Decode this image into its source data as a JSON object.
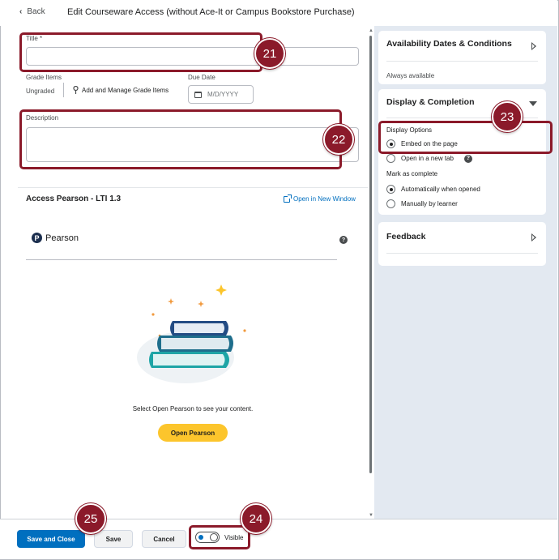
{
  "header": {
    "back_label": "Back",
    "title": "Edit Courseware Access (without Ace-It or Campus Bookstore Purchase)"
  },
  "form": {
    "title_label": "Title *",
    "title_value": "",
    "grade_items_label": "Grade Items",
    "grade_value": "Ungraded",
    "add_grade_label": "Add and Manage Grade Items",
    "due_date_label": "Due Date",
    "due_date_placeholder": "M/D/YYYY",
    "description_label": "Description",
    "description_value": ""
  },
  "lti": {
    "heading": "Access Pearson - LTI 1.3",
    "open_new_window": "Open in New Window",
    "logo_text": "Pearson",
    "logo_mark": "P",
    "help_glyph": "?",
    "message": "Select Open Pearson to see your content.",
    "open_button": "Open Pearson"
  },
  "right_panel": {
    "availability": {
      "title": "Availability Dates & Conditions",
      "status": "Always available"
    },
    "display": {
      "title": "Display & Completion",
      "display_options_label": "Display Options",
      "options": [
        {
          "label": "Embed on the page",
          "selected": true
        },
        {
          "label": "Open in a new tab",
          "selected": false
        }
      ],
      "mark_complete_label": "Mark as complete",
      "complete_options": [
        {
          "label": "Automatically when opened",
          "selected": true
        },
        {
          "label": "Manually by learner",
          "selected": false
        }
      ]
    },
    "feedback": {
      "title": "Feedback"
    }
  },
  "footer": {
    "save_close": "Save and Close",
    "save": "Save",
    "cancel": "Cancel",
    "visible_label": "Visible"
  },
  "callouts": {
    "c21": "21",
    "c22": "22",
    "c23": "23",
    "c24": "24",
    "c25": "25"
  },
  "colors": {
    "callout": "#8b1a2a",
    "primary": "#006fbf",
    "accent_yellow": "#fcc52c",
    "panel_bg": "#e3e9f1"
  }
}
